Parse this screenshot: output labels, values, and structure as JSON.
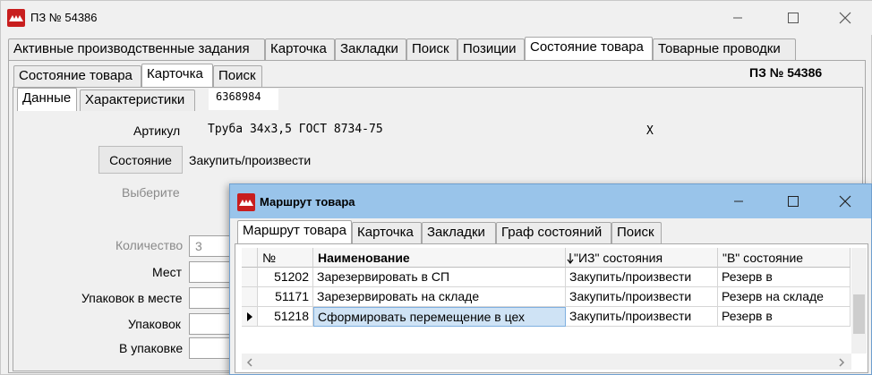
{
  "main": {
    "title": "ПЗ № 54386",
    "tabs": [
      "Активные производственные задания",
      "Карточка",
      "Закладки",
      "Поиск",
      "Позиции",
      "Состояние товара",
      "Товарные проводки"
    ],
    "subtabs": [
      "Состояние товара",
      "Карточка",
      "Поиск"
    ],
    "doc_label": "ПЗ № 54386",
    "inner_tabs": [
      "Данные",
      "Характеристики"
    ],
    "code": "6368984",
    "article_label": "Артикул",
    "article_value": "Труба 34х3,5 ГОСТ 8734-75",
    "clear_mark": "X",
    "state_button": "Состояние",
    "state_value": "Закупить/произвести",
    "choose_label": "Выберите",
    "quantity_label": "Количество",
    "quantity_value": "3",
    "places_label": "Мест",
    "packs_in_place_label": "Упаковок в месте",
    "packs_label": "Упаковок",
    "in_pack_label": "В упаковке"
  },
  "popup": {
    "title": "Маршрут товара",
    "tabs": [
      "Маршрут товара",
      "Карточка",
      "Закладки",
      "Граф состояний",
      "Поиск"
    ],
    "columns": [
      "№",
      "Наименование",
      "\"ИЗ\" состояния",
      "\"В\" состояние"
    ],
    "rows": [
      {
        "num": "51202",
        "name": "Зарезервировать в СП",
        "from": "Закупить/произвести",
        "to": "Резерв в"
      },
      {
        "num": "51171",
        "name": "Зарезервировать на складе",
        "from": "Закупить/произвести",
        "to": "Резерв на складе"
      },
      {
        "num": "51218",
        "name": "Сформировать перемещение в цех",
        "from": "Закупить/произвести",
        "to": "Резерв в"
      }
    ]
  },
  "colors": {
    "logo": "#c81e1e",
    "popup_titlebar": "#99c4ea",
    "selection": "#cfe3f5"
  },
  "icons": {
    "logo": "app-logo-icon",
    "minimize": "minimize-icon",
    "maximize": "maximize-icon",
    "close": "close-icon",
    "row_pointer": "row-pointer-icon",
    "sort": "sort-arrow-icon"
  }
}
